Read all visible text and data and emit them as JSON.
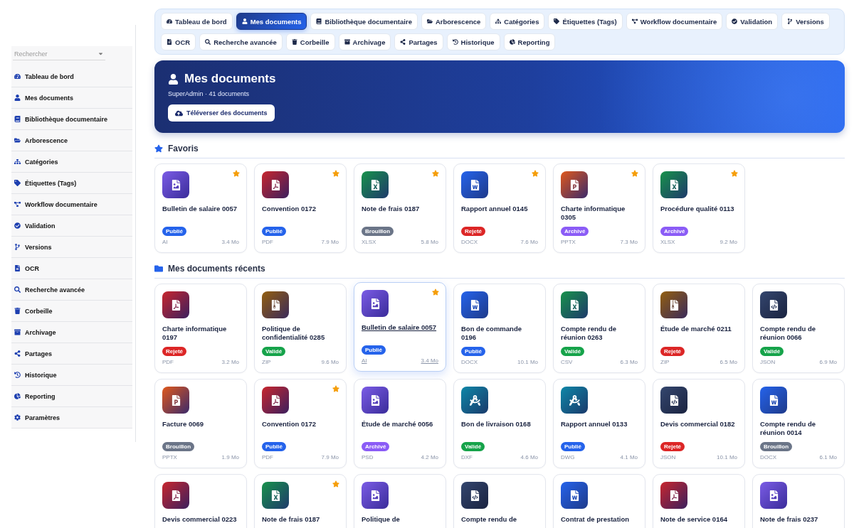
{
  "tabs": [
    {
      "label": "Tableau de bord",
      "selected": false
    },
    {
      "label": "Mes documents",
      "selected": true
    },
    {
      "label": "Bibliothèque documentaire",
      "selected": false
    },
    {
      "label": "Arborescence",
      "selected": false
    },
    {
      "label": "Catégories",
      "selected": false
    },
    {
      "label": "Étiquettes (Tags)",
      "selected": false
    },
    {
      "label": "Workflow documentaire",
      "selected": false
    },
    {
      "label": "Validation",
      "selected": false
    },
    {
      "label": "Versions",
      "selected": false
    },
    {
      "label": "OCR",
      "selected": false
    },
    {
      "label": "Recherche avancée",
      "selected": false
    },
    {
      "label": "Corbeille",
      "selected": false
    },
    {
      "label": "Archivage",
      "selected": false
    },
    {
      "label": "Partages",
      "selected": false
    },
    {
      "label": "Historique",
      "selected": false
    },
    {
      "label": "Reporting",
      "selected": false
    }
  ],
  "sidebar": {
    "search": {
      "placeholder": "Rechercher"
    },
    "items": [
      "Tableau de bord",
      "Mes documents",
      "Bibliothèque documentaire",
      "Arborescence",
      "Catégories",
      "Étiquettes (Tags)",
      "Workflow documentaire",
      "Validation",
      "Versions",
      "OCR",
      "Recherche avancée",
      "Corbeille",
      "Archivage",
      "Partages",
      "Historique",
      "Reporting",
      "Paramètres"
    ]
  },
  "banner": {
    "title": "Mes documents",
    "subtitle": "SuperAdmin · 41 documents",
    "button": "Téléverser des documents"
  },
  "favorites": {
    "title": "Favoris",
    "items": [
      {
        "kind": "image",
        "title": "Bulletin de salaire 0057",
        "status": "Publié",
        "color": "#2563eb",
        "type": "AI",
        "size": "3.4 Mo",
        "favorite": true,
        "hovered": false
      },
      {
        "kind": "pdf",
        "title": "Convention 0172",
        "status": "Publié",
        "color": "#2563eb",
        "type": "PDF",
        "size": "7.9 Mo",
        "favorite": true,
        "hovered": false
      },
      {
        "kind": "excel",
        "title": "Note de frais 0187",
        "status": "Brouillon",
        "color": "#6b7588",
        "type": "XLSX",
        "size": "5.8 Mo",
        "favorite": true,
        "hovered": false
      },
      {
        "kind": "word",
        "title": "Rapport annuel 0145",
        "status": "Rejeté",
        "color": "#dc2626",
        "type": "DOCX",
        "size": "7.6 Mo",
        "favorite": true,
        "hovered": false
      },
      {
        "kind": "ppt",
        "title": "Charte informatique 0305",
        "status": "Archivé",
        "color": "#8b5cf6",
        "type": "PPTX",
        "size": "7.3 Mo",
        "favorite": true,
        "hovered": false
      },
      {
        "kind": "excel",
        "title": "Procédure qualité 0113",
        "status": "Archivé",
        "color": "#8b5cf6",
        "type": "XLSX",
        "size": "9.2 Mo",
        "favorite": true,
        "hovered": false
      }
    ]
  },
  "recent": {
    "title": "Mes documents récents",
    "items": [
      {
        "kind": "pdf",
        "title": "Charte informatique 0197",
        "status": "Rejeté",
        "color": "#dc2626",
        "type": "PDF",
        "size": "3.2 Mo",
        "favorite": false,
        "hovered": false
      },
      {
        "kind": "zip",
        "title": "Politique de confidentialité 0285",
        "status": "Validé",
        "color": "#16a34a",
        "type": "ZIP",
        "size": "9.6 Mo",
        "favorite": false,
        "hovered": false
      },
      {
        "kind": "image",
        "title": "Bulletin de salaire 0057",
        "status": "Publié",
        "color": "#2563eb",
        "type": "AI",
        "size": "3.4 Mo",
        "favorite": true,
        "hovered": true
      },
      {
        "kind": "word",
        "title": "Bon de commande 0196",
        "status": "Publié",
        "color": "#2563eb",
        "type": "DOCX",
        "size": "10.1 Mo",
        "favorite": false,
        "hovered": false
      },
      {
        "kind": "excel",
        "title": "Compte rendu de réunion 0263",
        "status": "Validé",
        "color": "#16a34a",
        "type": "CSV",
        "size": "6.3 Mo",
        "favorite": false,
        "hovered": false
      },
      {
        "kind": "zip",
        "title": "Étude de marché 0211",
        "status": "Rejeté",
        "color": "#dc2626",
        "type": "ZIP",
        "size": "6.5 Mo",
        "favorite": false,
        "hovered": false
      },
      {
        "kind": "code",
        "title": "Compte rendu de réunion 0066",
        "status": "Validé",
        "color": "#16a34a",
        "type": "JSON",
        "size": "6.9 Mo",
        "favorite": false,
        "hovered": false
      },
      {
        "kind": "ppt",
        "title": "Facture 0069",
        "status": "Brouillon",
        "color": "#6b7588",
        "type": "PPTX",
        "size": "1.9 Mo",
        "favorite": false,
        "hovered": false
      },
      {
        "kind": "pdf",
        "title": "Convention 0172",
        "status": "Publié",
        "color": "#2563eb",
        "type": "PDF",
        "size": "7.9 Mo",
        "favorite": true,
        "hovered": false
      },
      {
        "kind": "image",
        "title": "Étude de marché 0056",
        "status": "Archivé",
        "color": "#8b5cf6",
        "type": "PSD",
        "size": "4.2 Mo",
        "favorite": false,
        "hovered": false
      },
      {
        "kind": "cad",
        "title": "Bon de livraison 0168",
        "status": "Validé",
        "color": "#16a34a",
        "type": "DXF",
        "size": "4.6 Mo",
        "favorite": false,
        "hovered": false
      },
      {
        "kind": "cad",
        "title": "Rapport annuel 0133",
        "status": "Publié",
        "color": "#2563eb",
        "type": "DWG",
        "size": "4.1 Mo",
        "favorite": false,
        "hovered": false
      },
      {
        "kind": "code",
        "title": "Devis commercial 0182",
        "status": "Rejeté",
        "color": "#dc2626",
        "type": "JSON",
        "size": "10.1 Mo",
        "favorite": false,
        "hovered": false
      },
      {
        "kind": "word",
        "title": "Compte rendu de réunion 0014",
        "status": "Brouillon",
        "color": "#6b7588",
        "type": "DOCX",
        "size": "6.1 Mo",
        "favorite": false,
        "hovered": false
      },
      {
        "kind": "pdf",
        "title": "Devis commercial 0223",
        "favorite": false,
        "hovered": false
      },
      {
        "kind": "excel",
        "title": "Note de frais 0187",
        "favorite": true,
        "hovered": false
      },
      {
        "kind": "image",
        "title": "Politique de",
        "favorite": false,
        "hovered": false
      },
      {
        "kind": "code",
        "title": "Compte rendu de",
        "favorite": false,
        "hovered": false
      },
      {
        "kind": "word",
        "title": "Contrat de prestation",
        "favorite": false,
        "hovered": false
      },
      {
        "kind": "pdf",
        "title": "Note de service 0164",
        "favorite": false,
        "hovered": false
      },
      {
        "kind": "image",
        "title": "Note de frais 0237",
        "favorite": false,
        "hovered": false
      }
    ]
  }
}
